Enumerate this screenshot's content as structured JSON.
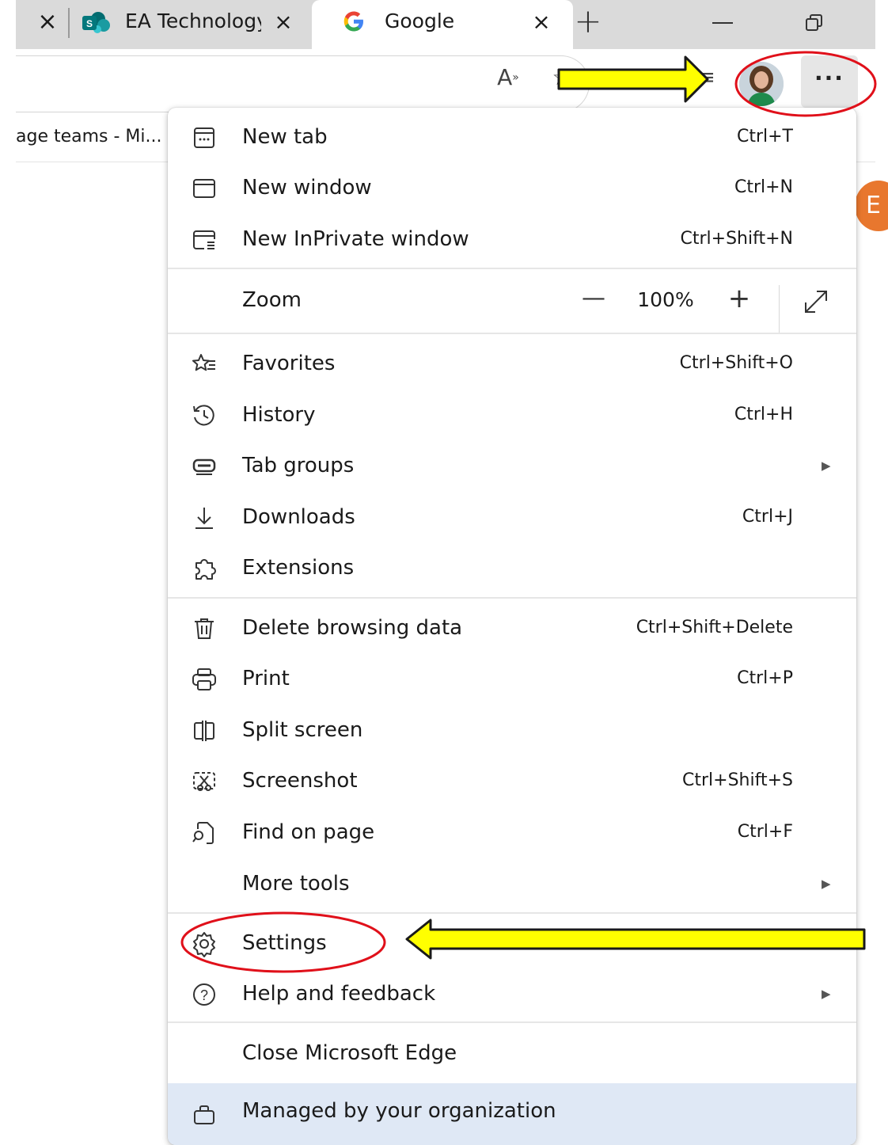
{
  "tabs": {
    "tab1_title": "EA Technology",
    "tab2_title": "Google",
    "close_glyph": "×",
    "new_tab_glyph": "+"
  },
  "toolbar": {
    "read_aloud_glyph": "A",
    "favorite_glyph": "☆",
    "more_glyph": "···"
  },
  "bookmarks": {
    "item1": "age teams - Mi..."
  },
  "page": {
    "avatar_letter": "E"
  },
  "menu": {
    "new_tab": {
      "label": "New tab",
      "shortcut": "Ctrl+T"
    },
    "new_window": {
      "label": "New window",
      "shortcut": "Ctrl+N"
    },
    "new_inprivate": {
      "label": "New InPrivate window",
      "shortcut": "Ctrl+Shift+N"
    },
    "zoom": {
      "label": "Zoom",
      "minus": "—",
      "value": "100%",
      "plus": "+"
    },
    "favorites": {
      "label": "Favorites",
      "shortcut": "Ctrl+Shift+O"
    },
    "history": {
      "label": "History",
      "shortcut": "Ctrl+H"
    },
    "tab_groups": {
      "label": "Tab groups"
    },
    "downloads": {
      "label": "Downloads",
      "shortcut": "Ctrl+J"
    },
    "extensions": {
      "label": "Extensions"
    },
    "delete_browsing": {
      "label": "Delete browsing data",
      "shortcut": "Ctrl+Shift+Delete"
    },
    "print": {
      "label": "Print",
      "shortcut": "Ctrl+P"
    },
    "split_screen": {
      "label": "Split screen"
    },
    "screenshot": {
      "label": "Screenshot",
      "shortcut": "Ctrl+Shift+S"
    },
    "find_on_page": {
      "label": "Find on page",
      "shortcut": "Ctrl+F"
    },
    "more_tools": {
      "label": "More tools"
    },
    "settings": {
      "label": "Settings"
    },
    "help_feedback": {
      "label": "Help and feedback"
    },
    "close_edge": {
      "label": "Close Microsoft Edge"
    },
    "managed": {
      "label": "Managed by your organization"
    },
    "submenu_arrow": "▶"
  },
  "colors": {
    "annotation_arrow_fill": "#ffff00",
    "annotation_circle": "#e0101a",
    "managed_highlight": "#dfe8f5"
  },
  "icons": [
    "close-icon",
    "sharepoint-icon",
    "google-icon",
    "plus-icon",
    "minimize-icon",
    "restore-icon",
    "read-aloud-icon",
    "star-icon",
    "collections-icon",
    "more-icon",
    "new-tab-icon",
    "new-window-icon",
    "inprivate-icon",
    "favorites-icon",
    "history-icon",
    "tab-groups-icon",
    "download-icon",
    "extensions-icon",
    "trash-icon",
    "printer-icon",
    "split-screen-icon",
    "screenshot-icon",
    "find-icon",
    "gear-icon",
    "help-icon",
    "briefcase-icon",
    "fullscreen-icon",
    "chevron-right-icon"
  ]
}
